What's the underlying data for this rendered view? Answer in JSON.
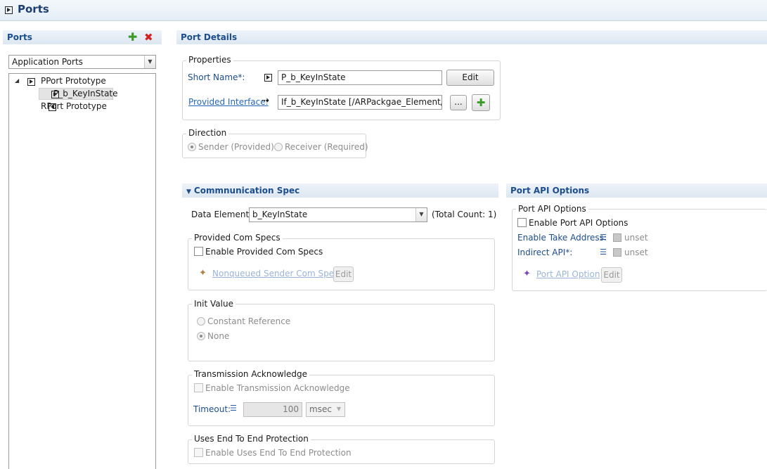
{
  "window": {
    "title": "Ports"
  },
  "ports_panel": {
    "title": "Ports",
    "port_type": "Application Ports",
    "tree": {
      "pport": "PPort Prototype",
      "pport_child": "P_b_KeyInState",
      "rport": "RPort Prototype"
    }
  },
  "details": {
    "title": "Port Details",
    "properties": {
      "legend": "Properties",
      "short_name_label": "Short Name*:",
      "short_name_value": "P_b_KeyInState",
      "edit_label": "Edit",
      "provided_interface_label": "Provided Interface:",
      "provided_interface_value": "If_b_KeyInState [/ARPackgae_Element/If_b_",
      "browse_label": "..."
    },
    "direction": {
      "legend": "Direction",
      "sender": "Sender (Provided)",
      "receiver": "Receiver (Required)"
    }
  },
  "comm_spec": {
    "title": "Commnunication Spec",
    "data_elements_label": "Data Elements",
    "data_elements_value": "b_KeyInState",
    "total_count": "(Total Count: 1)",
    "provided": {
      "legend": "Provided Com Specs",
      "enable": "Enable Provided Com Specs",
      "link": "Nonqueued Sender Com Spec",
      "edit": "Edit"
    },
    "init_value": {
      "legend": "Init Value",
      "constant": "Constant Reference",
      "none": "None"
    },
    "transmission": {
      "legend": "Transmission Acknowledge",
      "enable": "Enable Transmission Acknowledge",
      "timeout_label": "Timeout:",
      "timeout_value": "100",
      "unit": "msec"
    },
    "e2e": {
      "legend": "Uses End To End Protection",
      "enable": "Enable Uses End To End Protection"
    }
  },
  "api_options": {
    "title": "Port API Options",
    "legend": "Port API Options",
    "enable": "Enable Port API Options",
    "take_address_label": "Enable Take Address:",
    "take_address_value": "unset",
    "indirect_label": "Indirect API*:",
    "indirect_value": "unset",
    "link": "Port API Option",
    "edit": "Edit"
  }
}
